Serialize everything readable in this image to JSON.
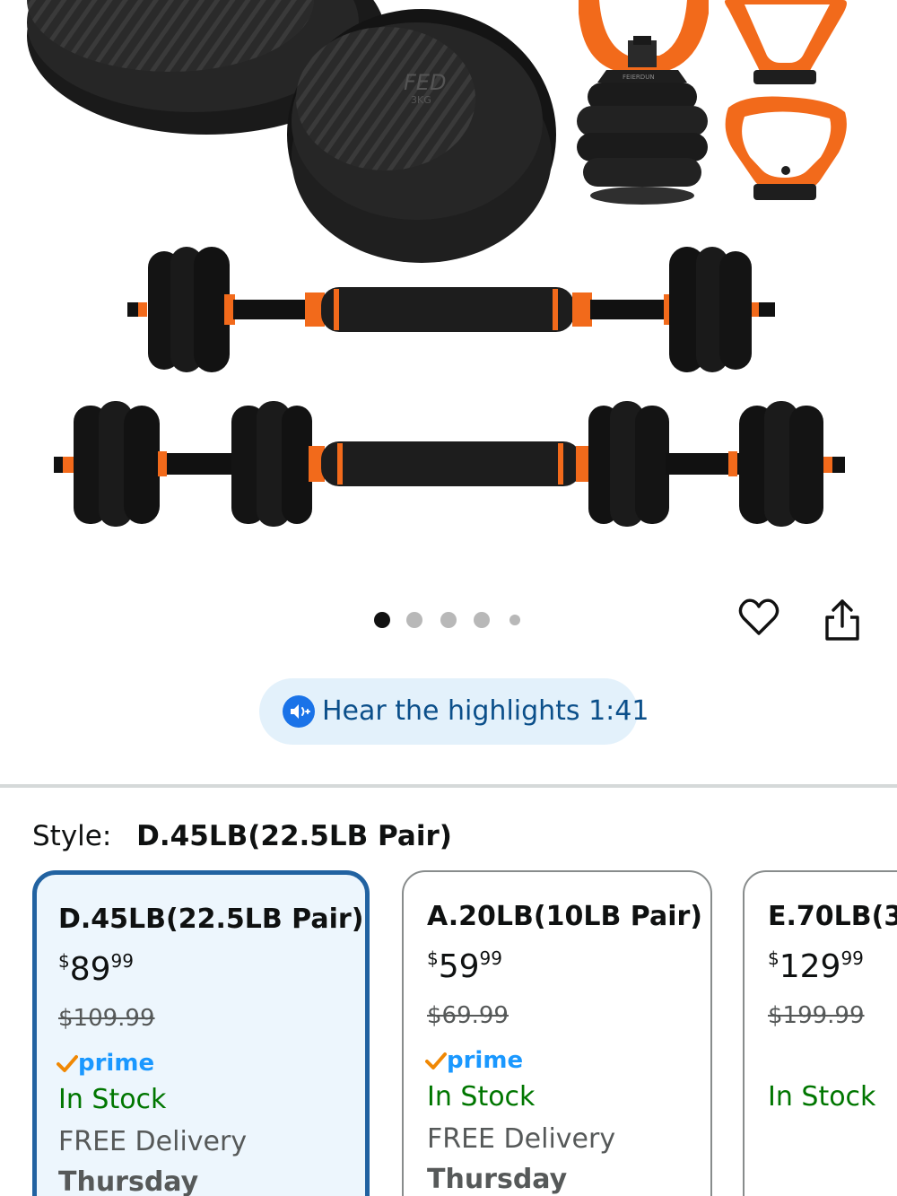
{
  "product_gallery": {
    "image_alt": "Adjustable dumbbell, barbell and kettlebell set",
    "brand_mark": "FED",
    "plate_weight_mark": "3KG",
    "kettle_handle_mark": "FEIERDUN",
    "image_count": 5,
    "active_index": 0
  },
  "actions": {
    "favorite_icon": "heart-outline-icon",
    "share_icon": "share-icon"
  },
  "audio": {
    "icon": "audio-speaker-icon",
    "label": "Hear the highlights 1:41"
  },
  "style": {
    "key": "Style:",
    "value": "D.45LB(22.5LB Pair)"
  },
  "variants": [
    {
      "title": "D.45LB(22.5LB Pair)",
      "currency": "$",
      "price_whole": "89",
      "price_fraction": "99",
      "list_price": "$109.99",
      "prime": "prime",
      "stock": "In Stock",
      "delivery": "FREE Delivery",
      "delivery_day": "Thursday",
      "selected": true
    },
    {
      "title": "A.20LB(10LB Pair)",
      "currency": "$",
      "price_whole": "59",
      "price_fraction": "99",
      "list_price": "$69.99",
      "prime": "prime",
      "stock": "In Stock",
      "delivery": "FREE Delivery",
      "delivery_day": "Thursday",
      "selected": false
    },
    {
      "title": "E.70LB(3",
      "currency": "$",
      "price_whole": "129",
      "price_fraction": "99",
      "list_price": "$199.99",
      "stock": "In Stock",
      "selected": false
    }
  ],
  "colors": {
    "accent_orange": "#f26a1b",
    "selected_border": "#2162a1",
    "selected_bg": "#edf6fd",
    "stock_green": "#007600",
    "prime_blue": "#1a98ff",
    "pill_bg": "#e3f1fb"
  }
}
